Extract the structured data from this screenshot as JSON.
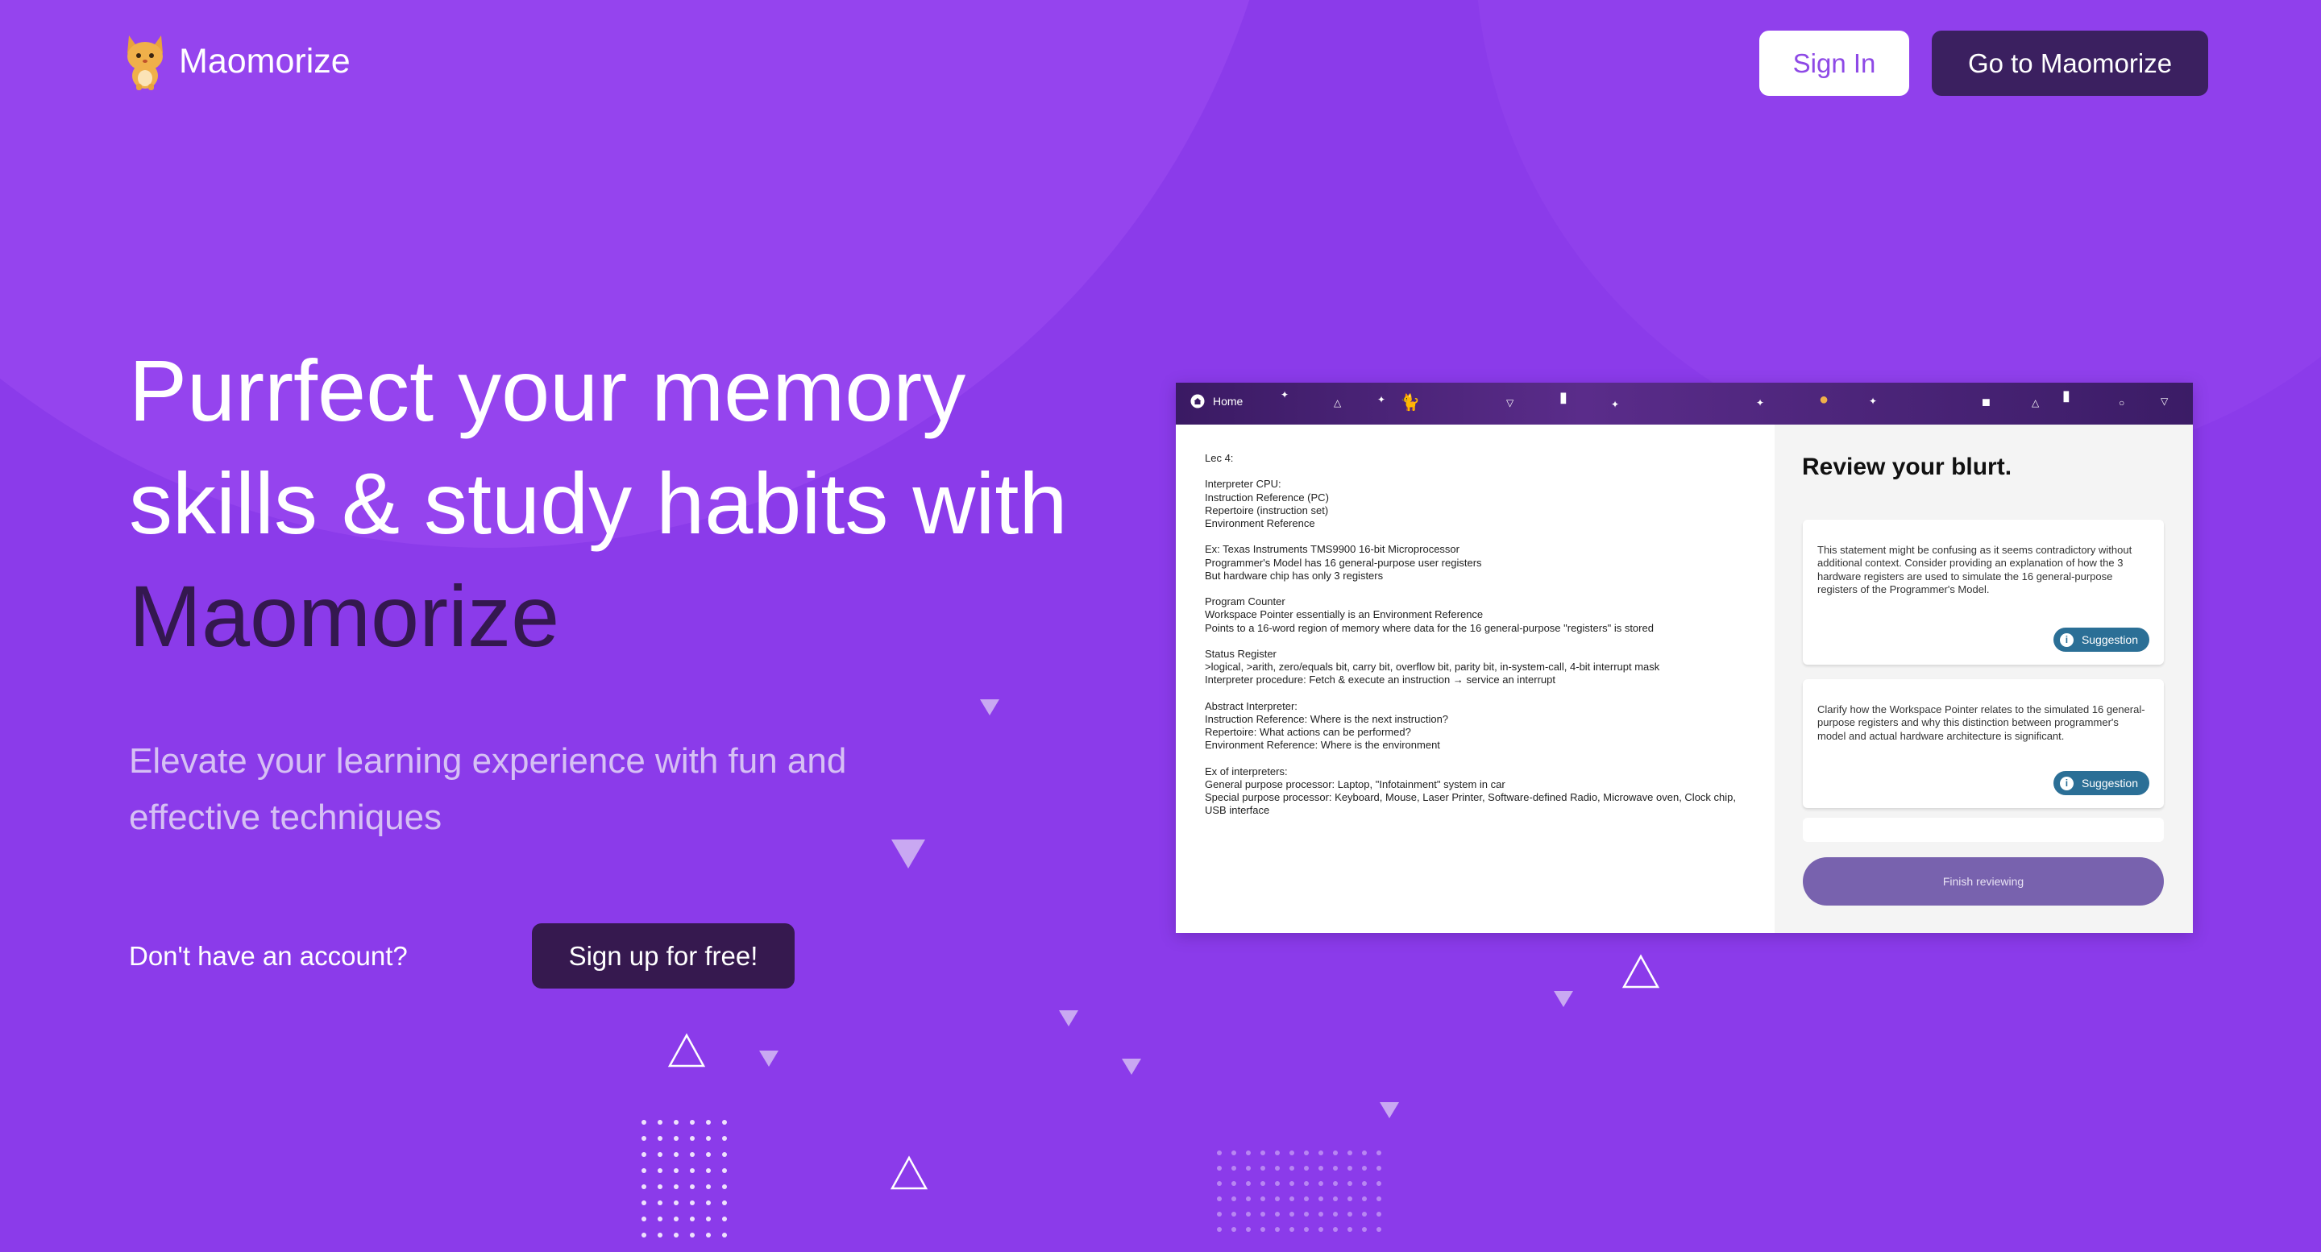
{
  "header": {
    "logo_text": "Maomorize",
    "sign_in_label": "Sign In",
    "go_label": "Go to Maomorize"
  },
  "hero": {
    "title_main": "Purrfect your memory skills & study habits with",
    "title_brand": "Maomorize",
    "subtitle": "Elevate your learning experience with fun and effective techniques",
    "no_account_text": "Don't have an account?",
    "signup_label": "Sign up for free!"
  },
  "preview": {
    "nav_home_label": "Home",
    "notes": "Lec 4:\n\nInterpreter CPU:\nInstruction Reference (PC)\nRepertoire (instruction set)\nEnvironment Reference\n\nEx: Texas Instruments TMS9900 16-bit Microprocessor\nProgrammer's Model has 16 general-purpose user registers\nBut hardware chip has only 3 registers\n\nProgram Counter\nWorkspace Pointer essentially is an Environment Reference\nPoints to a 16-word region of memory where data for the 16 general-purpose \"registers\" is stored\n\nStatus Register\n>logical, >arith, zero/equals bit, carry bit, overflow bit, parity bit, in-system-call, 4-bit interrupt mask\nInterpreter procedure: Fetch & execute an instruction → service an interrupt\n\nAbstract Interpreter:\nInstruction Reference: Where is the next instruction?\nRepertoire: What actions can be performed?\nEnvironment Reference: Where is the environment\n\nEx of interpreters:\nGeneral purpose processor: Laptop, \"Infotainment\" system in car\nSpecial purpose processor: Keyboard, Mouse, Laser Printer, Software-defined Radio, Microwave oven, Clock chip, USB interface",
    "review_heading": "Review your blurt.",
    "cards": [
      {
        "text": "This statement might be confusing as it seems contradictory without additional context. Consider providing an explanation of how the 3 hardware registers are used to simulate the 16 general-purpose registers of the Programmer's Model.",
        "badge": "Suggestion"
      },
      {
        "text": "Clarify how the Workspace Pointer relates to the simulated 16 general-purpose registers and why this distinction between programmer's model and actual hardware architecture is significant.",
        "badge": "Suggestion"
      }
    ],
    "finish_label": "Finish reviewing"
  },
  "colors": {
    "background": "#8b3bea",
    "dark_button": "#3b2060",
    "sign_in_text": "#8e49e6",
    "suggestion_badge": "#2b6f96",
    "finish_button": "#7862ae"
  },
  "icons": [
    "cat-logo-icon",
    "home-icon",
    "info-icon",
    "triangle-decoration-icon",
    "dot-grid-decoration"
  ]
}
